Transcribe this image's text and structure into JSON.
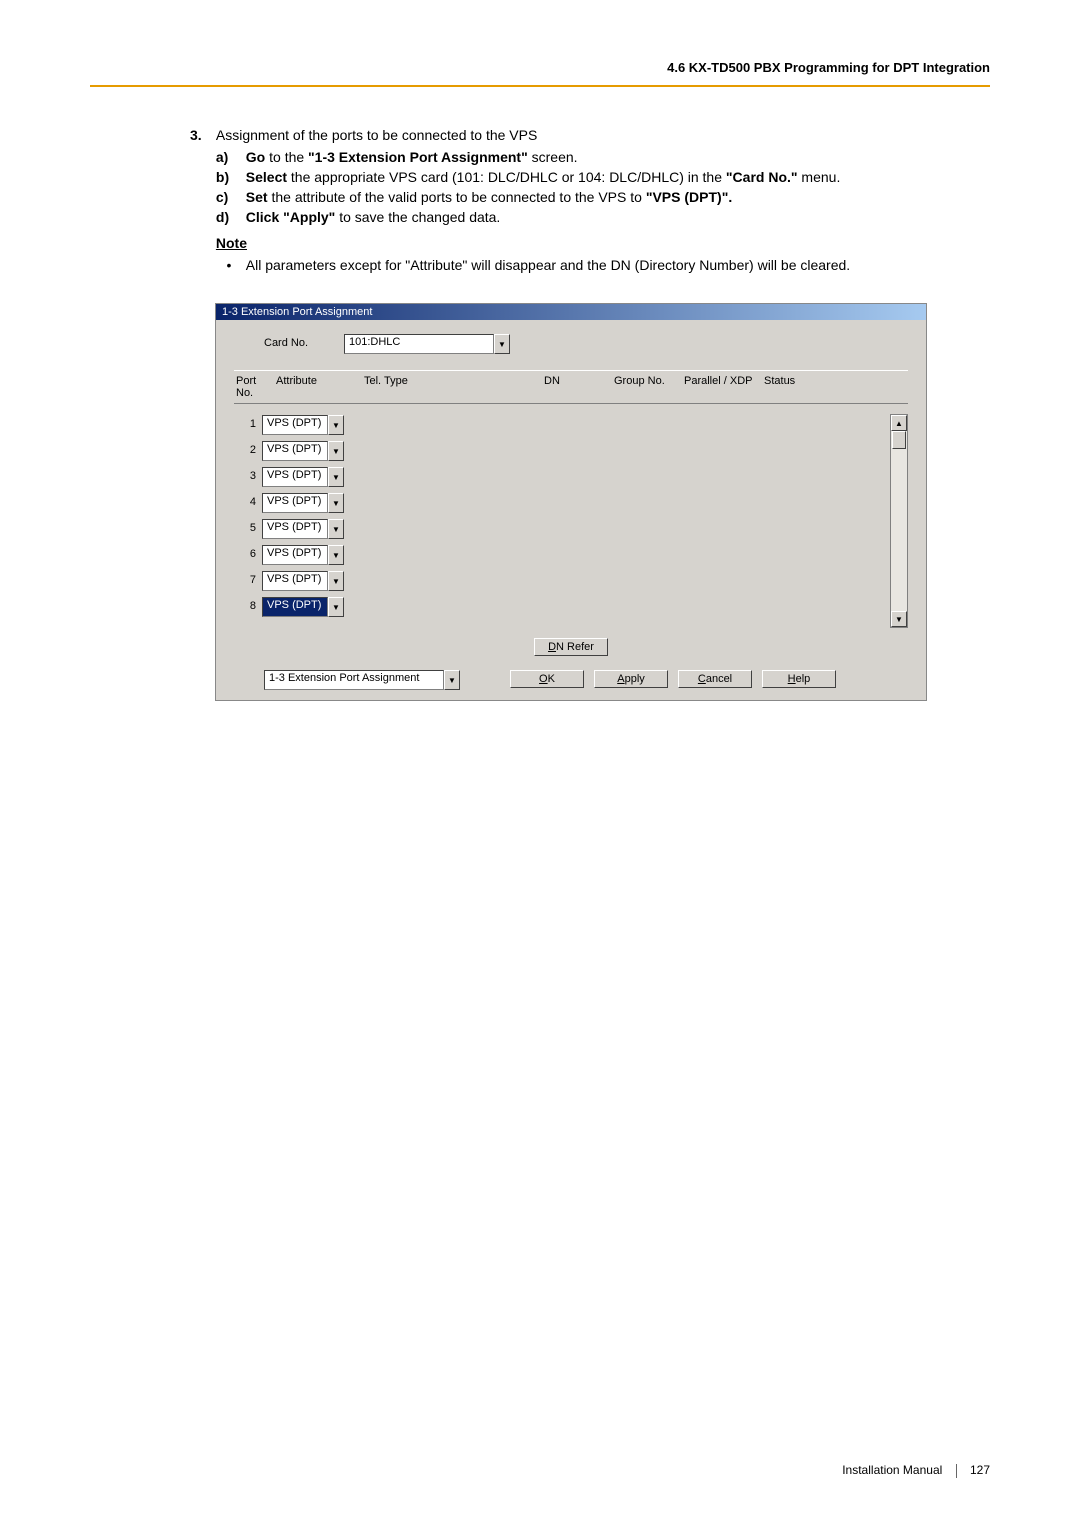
{
  "header": {
    "section_title": "4.6 KX-TD500 PBX Programming for DPT Integration"
  },
  "step": {
    "number": "3.",
    "intro": "Assignment of the ports to be connected to the VPS",
    "subs": [
      {
        "letter": "a)",
        "bold": "Go",
        "rest_before": " to the ",
        "quoted": "\"1-3 Extension Port Assignment\"",
        "rest_after": " screen."
      },
      {
        "letter": "b)",
        "bold": "Select",
        "rest_before": " the appropriate VPS card (101: DLC/DHLC or 104: DLC/DHLC) in the ",
        "quoted": "\"Card No.\"",
        "rest_after": " menu."
      },
      {
        "letter": "c)",
        "bold": "Set",
        "rest_before": " the attribute of the valid ports to be connected to the VPS to ",
        "quoted": "\"VPS (DPT)\".",
        "rest_after": ""
      },
      {
        "letter": "d)",
        "bold": "Click",
        "rest_before": " ",
        "quoted": "\"Apply\"",
        "rest_after": " to save the changed data."
      }
    ],
    "note_label": "Note",
    "note_bullet": "All parameters except for \"Attribute\" will disappear and the DN (Directory Number) will be cleared."
  },
  "window": {
    "title": "1-3 Extension Port Assignment",
    "card_no_label": "Card No.",
    "card_no_value": "101:DHLC",
    "headers": {
      "port": "Port No.",
      "attribute": "Attribute",
      "tel_type": "Tel. Type",
      "dn": "DN",
      "group_no": "Group No.",
      "parallel": "Parallel / XDP",
      "status": "Status"
    },
    "rows": [
      {
        "no": "1",
        "attr": "VPS (DPT)",
        "selected": false
      },
      {
        "no": "2",
        "attr": "VPS (DPT)",
        "selected": false
      },
      {
        "no": "3",
        "attr": "VPS (DPT)",
        "selected": false
      },
      {
        "no": "4",
        "attr": "VPS (DPT)",
        "selected": false
      },
      {
        "no": "5",
        "attr": "VPS (DPT)",
        "selected": false
      },
      {
        "no": "6",
        "attr": "VPS (DPT)",
        "selected": false
      },
      {
        "no": "7",
        "attr": "VPS (DPT)",
        "selected": false
      },
      {
        "no": "8",
        "attr": "VPS (DPT)",
        "selected": true
      }
    ],
    "dn_refer_label": "DN Refer",
    "bottom_select_value": "1-3 Extension Port Assignment",
    "buttons": {
      "ok": "OK",
      "apply": "Apply",
      "cancel": "Cancel",
      "help": "Help"
    }
  },
  "footer": {
    "manual": "Installation Manual",
    "page": "127"
  }
}
